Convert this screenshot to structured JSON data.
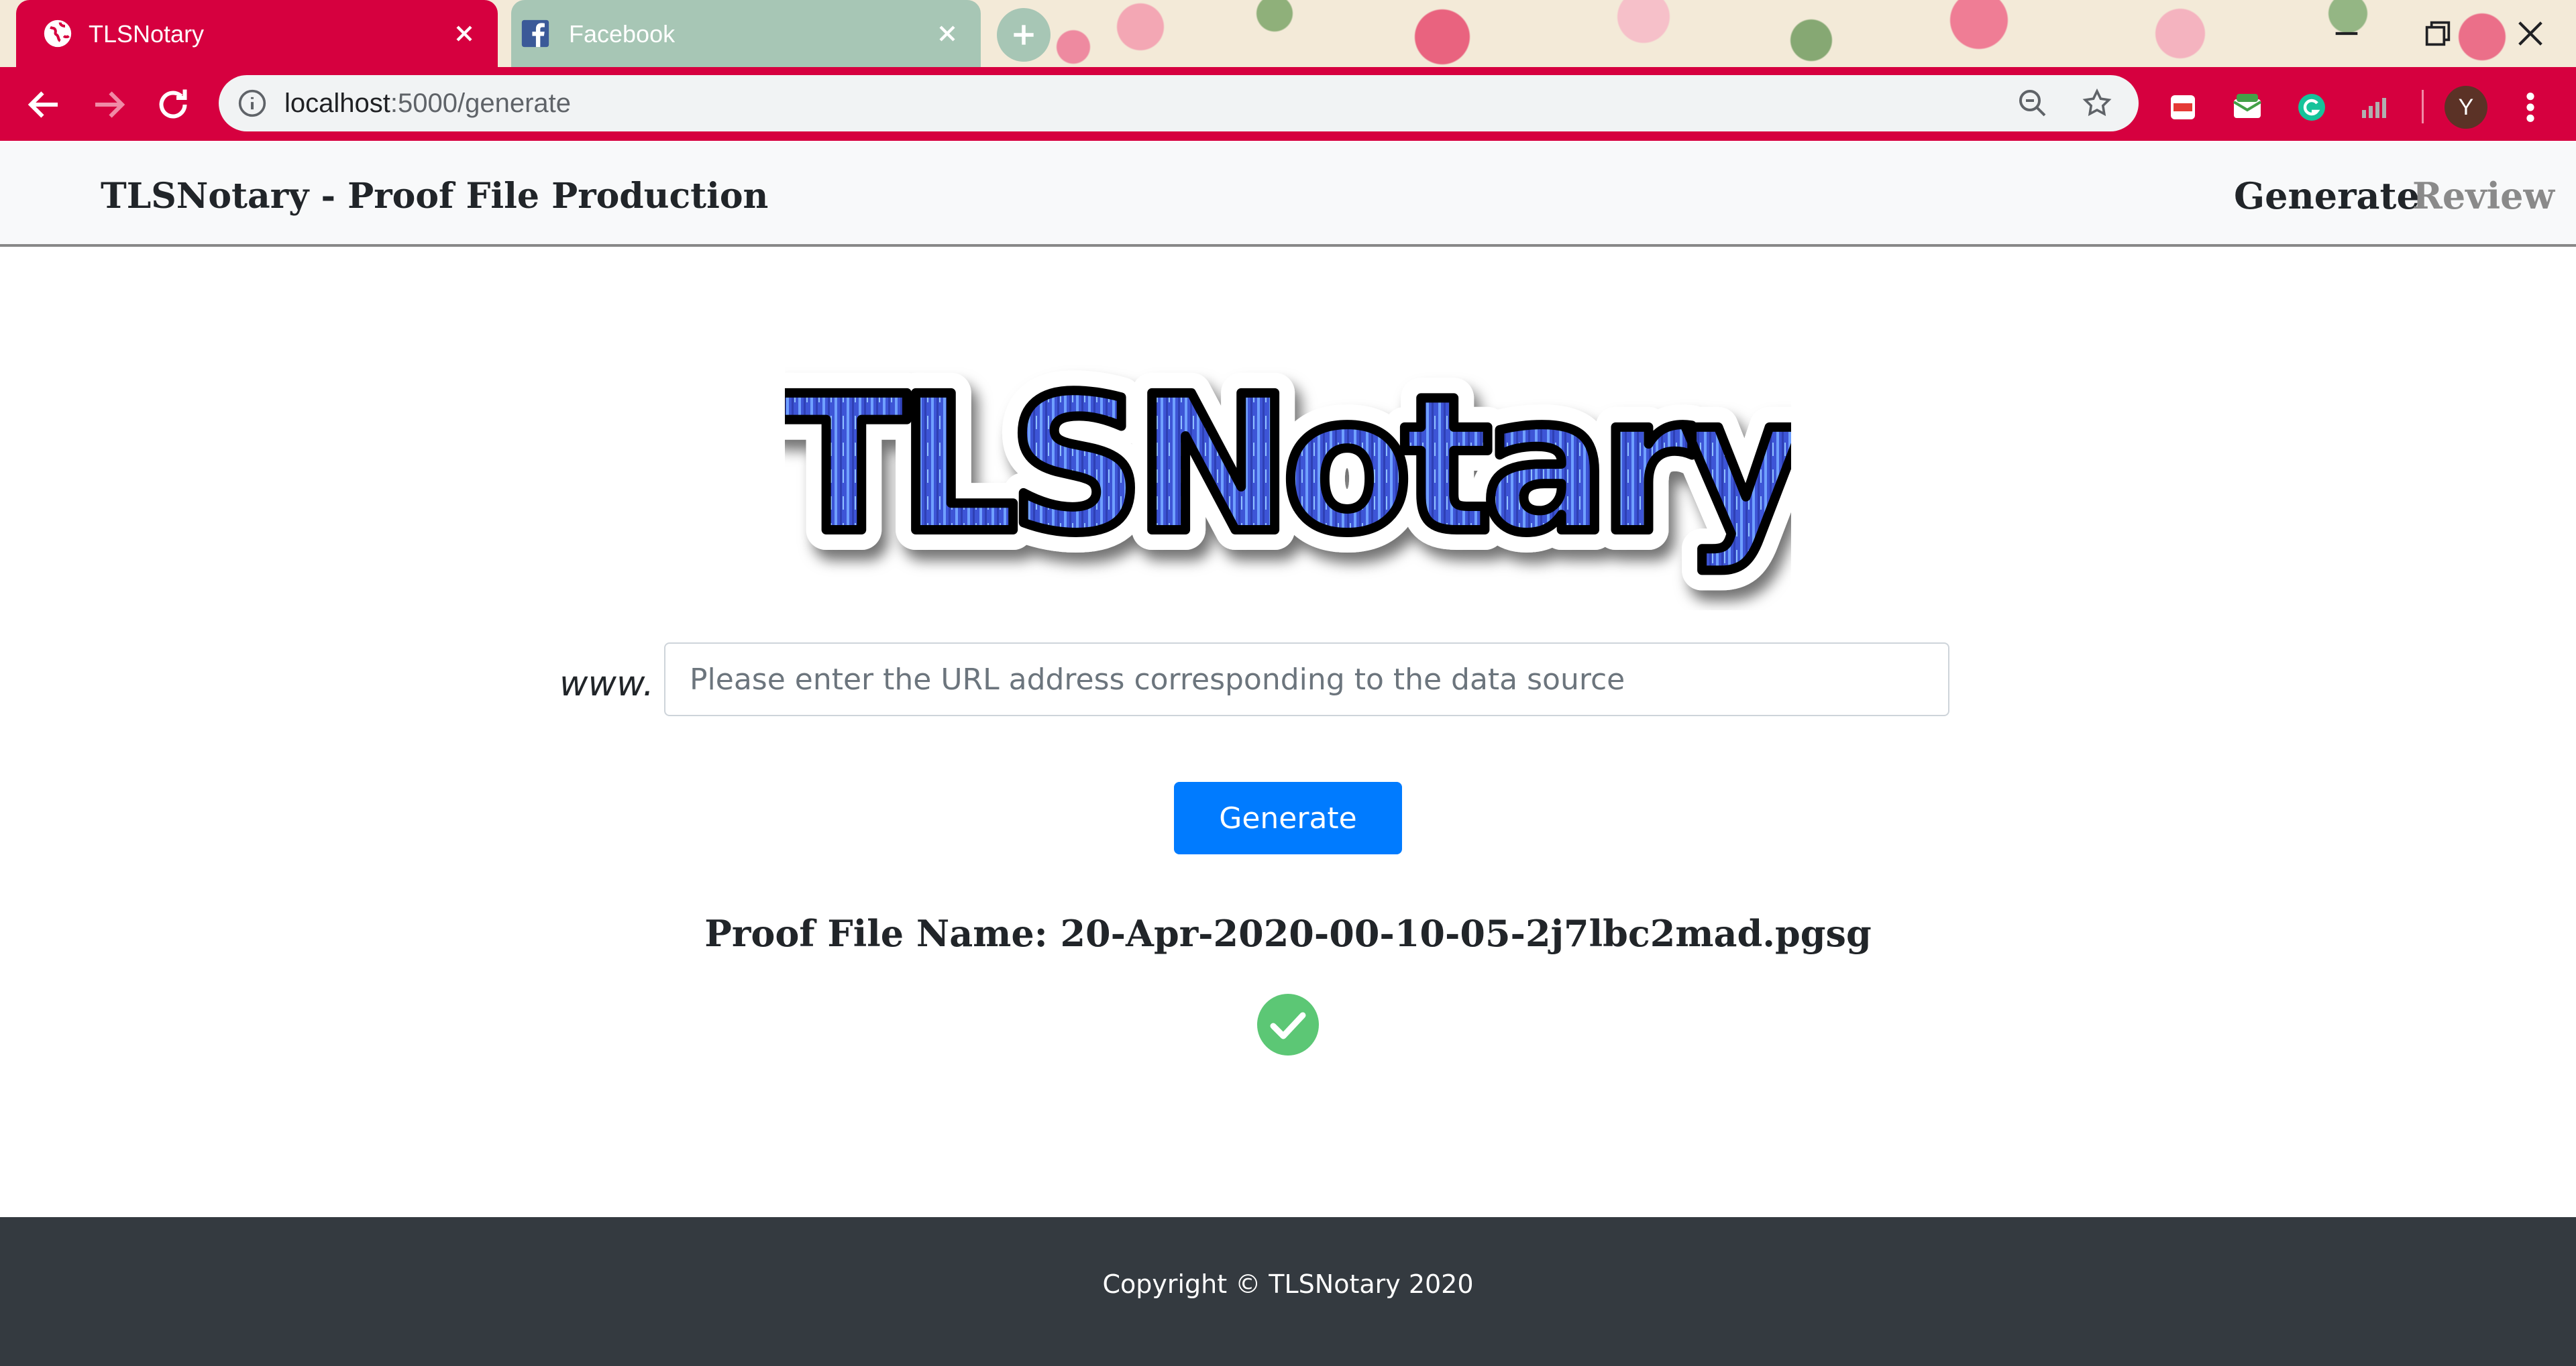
{
  "browser": {
    "tabs": [
      {
        "title": "TLSNotary",
        "active": true,
        "icon": "globe-icon"
      },
      {
        "title": "Facebook",
        "active": false,
        "icon": "facebook-icon"
      }
    ],
    "url_host": "localhost",
    "url_path": ":5000/generate",
    "avatar_letter": "Y",
    "accent_color": "#d6003f"
  },
  "site": {
    "brand": "TLSNotary - Proof File Production",
    "nav": {
      "generate": "Generate",
      "review": "Review"
    },
    "logo_text": "TLSNotary"
  },
  "form": {
    "prefix_label": "www.",
    "url_placeholder": "Please enter the URL address corresponding to the data source",
    "url_value": "",
    "generate_button": "Generate"
  },
  "result": {
    "proof_file_name": "Proof File Name: 20-Apr-2020-00-10-05-2j7lbc2mad.pgsg",
    "status": "success",
    "status_color": "#5cc775"
  },
  "footer": {
    "copyright": "Copyright © TLSNotary 2020"
  }
}
